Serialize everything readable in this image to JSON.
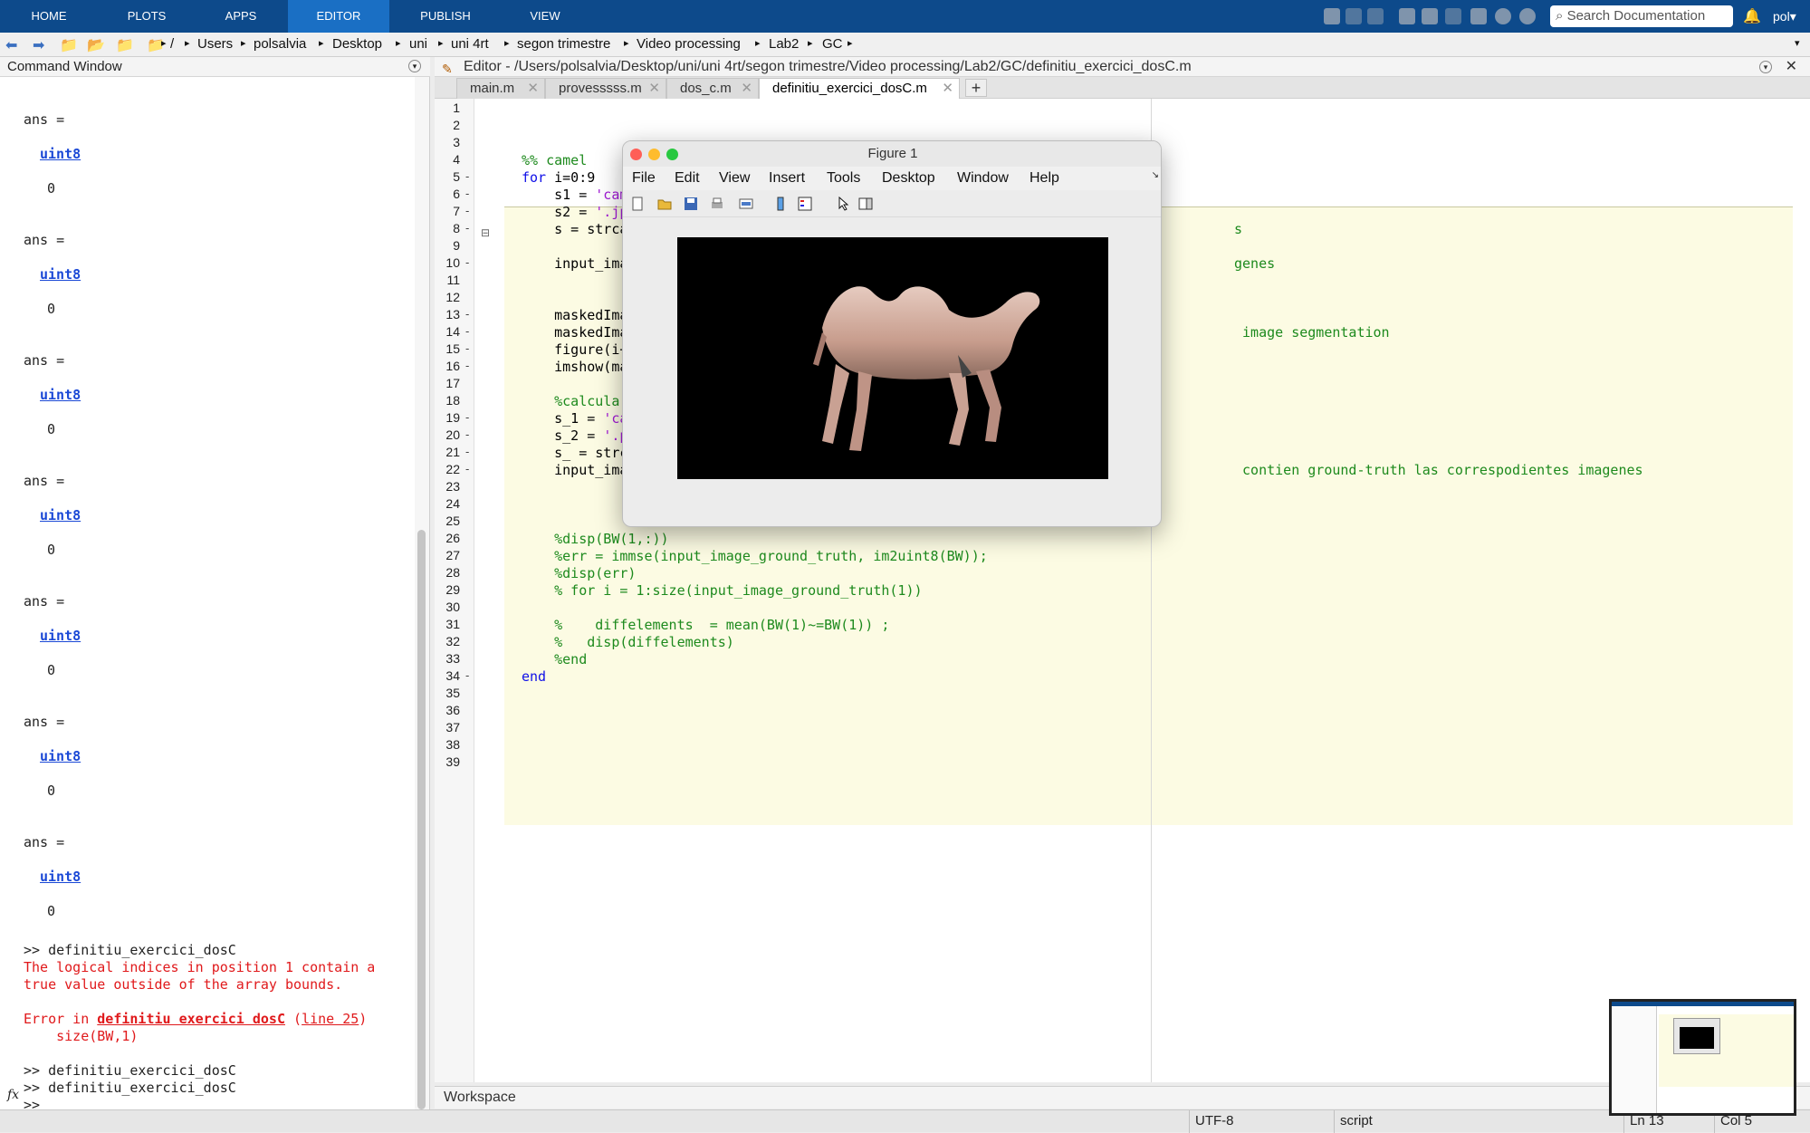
{
  "ribbon": {
    "tabs": [
      "HOME",
      "PLOTS",
      "APPS",
      "EDITOR",
      "PUBLISH",
      "VIEW"
    ],
    "active_tab": "EDITOR",
    "search_placeholder": "Search Documentation",
    "user": "pol",
    "accent": "#0d4a8b",
    "active_color": "#1a6fc4"
  },
  "address": {
    "crumbs": [
      "/",
      "Users",
      "polsalvia",
      "Desktop",
      "uni",
      "uni 4rt",
      "segon trimestre",
      "Video processing",
      "Lab2",
      "GC"
    ]
  },
  "command_window": {
    "title": "Command Window",
    "ans_label": "ans =",
    "uint_label": "uint8",
    "zero": "0",
    "cmd1": ">> definitiu_exercici_dosC",
    "err1": "The logical indices in position 1 contain a",
    "err2": "true value outside of the array bounds.",
    "err3_prefix": "Error in ",
    "err3_link": "definitiu exercici dosC",
    "err3_mid": " (",
    "err3_line": "line 25",
    "err3_suffix": ")",
    "err4": "    size(BW,1)",
    "cmd2": ">> definitiu_exercici_dosC",
    "cmd3": ">> definitiu_exercici_dosC",
    "prompt": ">>",
    "fx": "fx"
  },
  "editor": {
    "title": "Editor - /Users/polsalvia/Desktop/uni/uni 4rt/segon trimestre/Video processing/Lab2/GC/definitiu_exercici_dosC.m",
    "tabs": [
      "main.m",
      "provesssss.m",
      "dos_c.m",
      "definitiu_exercici_dosC.m"
    ],
    "active_tab": "definitiu_exercici_dosC.m",
    "code": {
      "l4": "%% camel",
      "l5_kw": "for",
      "l5_rest": " i=0:9",
      "l6_a": "    s1 = ",
      "l6_str": "'camel",
      "l7_a": "    s2 = ",
      "l7_str": "'.jpg'",
      "l8": "    s = strcat(",
      "l8_tail": "s",
      "l10": "    input_image",
      "l10_tail": "genes",
      "l13": "    maskedImage",
      "l14": "    maskedImage",
      "l14_tail": " image segmentation",
      "l15": "    figure(i+1)",
      "l16": "    imshow(mask",
      "l18": "    %calcular e",
      "l19_a": "    s_1 = ",
      "l19_str": "'came",
      "l20_a": "    s_2 = ",
      "l20_str": "'.png",
      "l21": "    s_ = strcat",
      "l22": "    input_image",
      "l22_tail": " contien ground-truth las correspodientes imagenes",
      "l26": "    %disp(BW(1,:))",
      "l27": "    %err = immse(input_image_ground_truth, im2uint8(BW));",
      "l28": "    %disp(err)",
      "l29": "    % for i = 1:size(input_image_ground_truth(1))",
      "l31": "    %    diffelements  = mean(BW(1)~=BW(1)) ;",
      "l32": "    %   disp(diffelements)",
      "l33": "    %end",
      "l34": "end"
    }
  },
  "workspace": {
    "label": "Workspace"
  },
  "status": {
    "encoding": "UTF-8",
    "type": "script",
    "ln": "Ln  13",
    "col": "Col  5"
  },
  "figure": {
    "title": "Figure 1",
    "menus": [
      "File",
      "Edit",
      "View",
      "Insert",
      "Tools",
      "Desktop",
      "Window",
      "Help"
    ]
  }
}
